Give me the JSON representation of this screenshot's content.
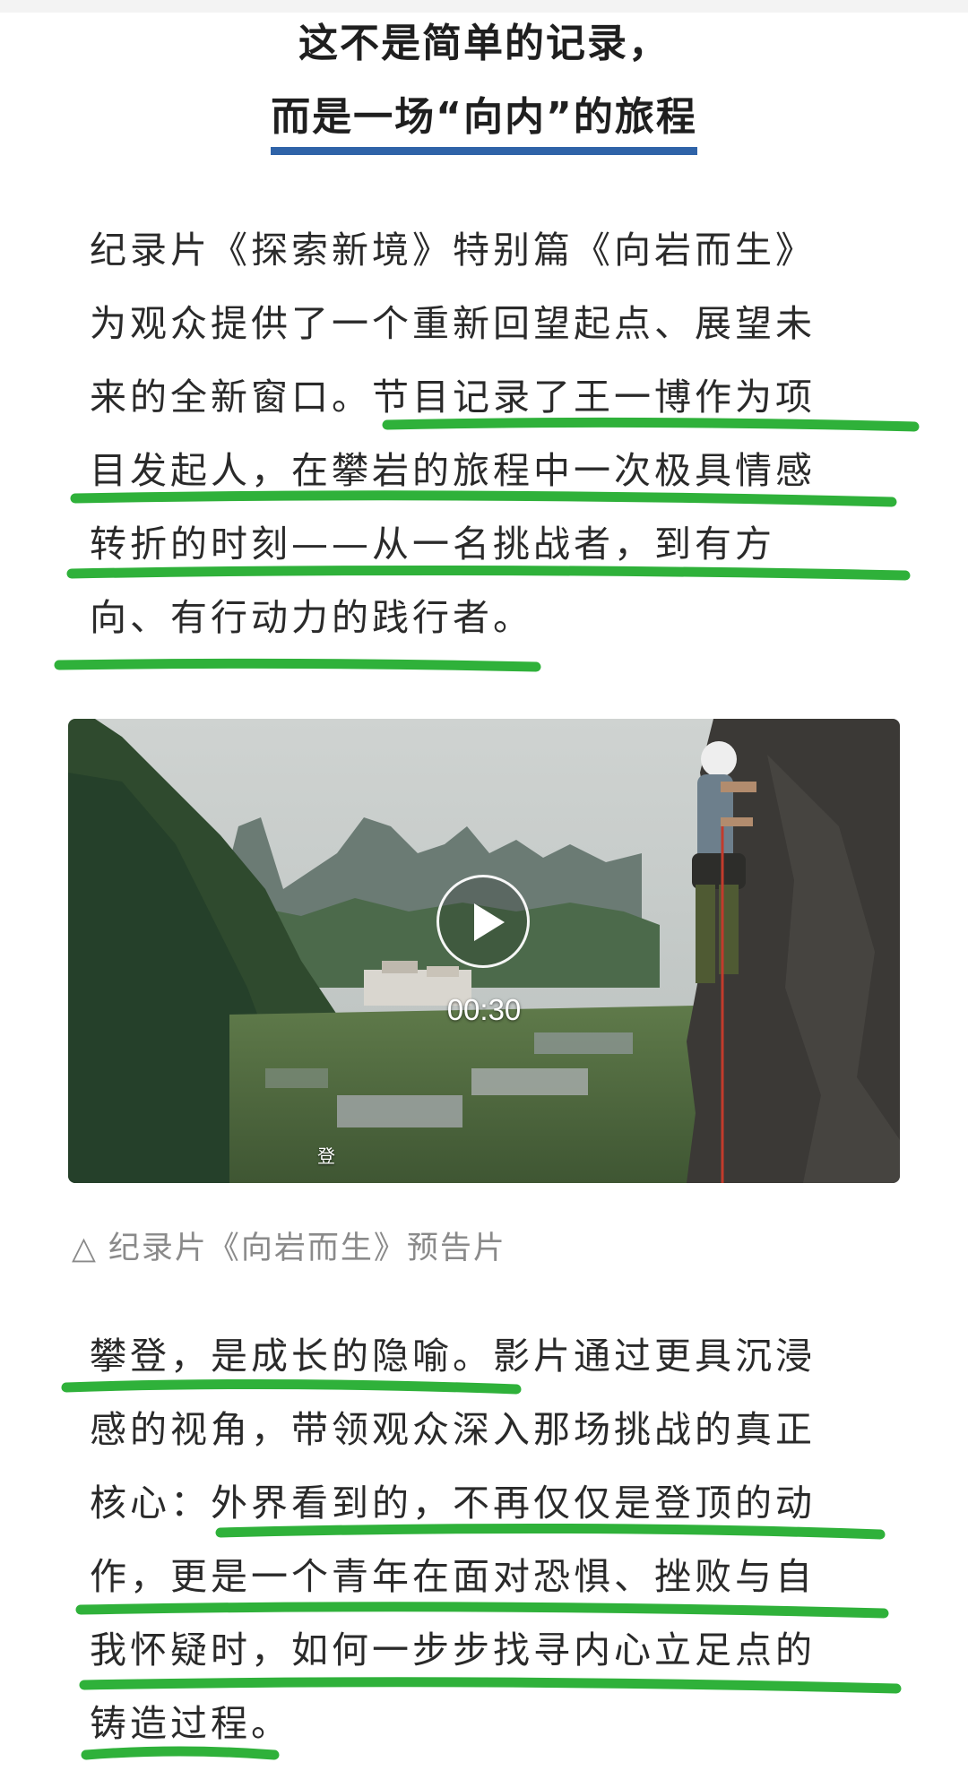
{
  "header": {
    "title_line1": "这不是简单的记录，",
    "title_line2": "而是一场“向内”的旅程"
  },
  "paragraph1": {
    "lines": [
      "纪录片《探索新境》特别篇《向岩而生》",
      "为观众提供了一个重新回望起点、展望未",
      "来的全新窗口。节目记录了王一博作为项",
      "目发起人，在攀岩的旅程中一次极具情感",
      "转折的时刻——从一名挑战者，到有方",
      "向、有行动力的践行者。"
    ]
  },
  "video": {
    "duration": "00:30",
    "subtitle_fragment": "登",
    "play_icon": "play-icon"
  },
  "caption": {
    "icon": "△",
    "text": "纪录片《向岩而生》预告片"
  },
  "paragraph2": {
    "lines": [
      "攀登，是成长的隐喻。影片通过更具沉浸",
      "感的视角，带领观众深入那场挑战的真正",
      "核心：外界看到的，不再仅仅是登顶的动",
      "作，更是一个青年在面对恐惧、挫败与自",
      "我怀疑时，如何一步步找寻内心立足点的",
      "铸造过程。"
    ]
  },
  "colors": {
    "title_bar": "#2f63a8",
    "highlight_ink": "#2fb13a",
    "body_text": "#2a2a2a",
    "caption_text": "#8a8a8a"
  }
}
